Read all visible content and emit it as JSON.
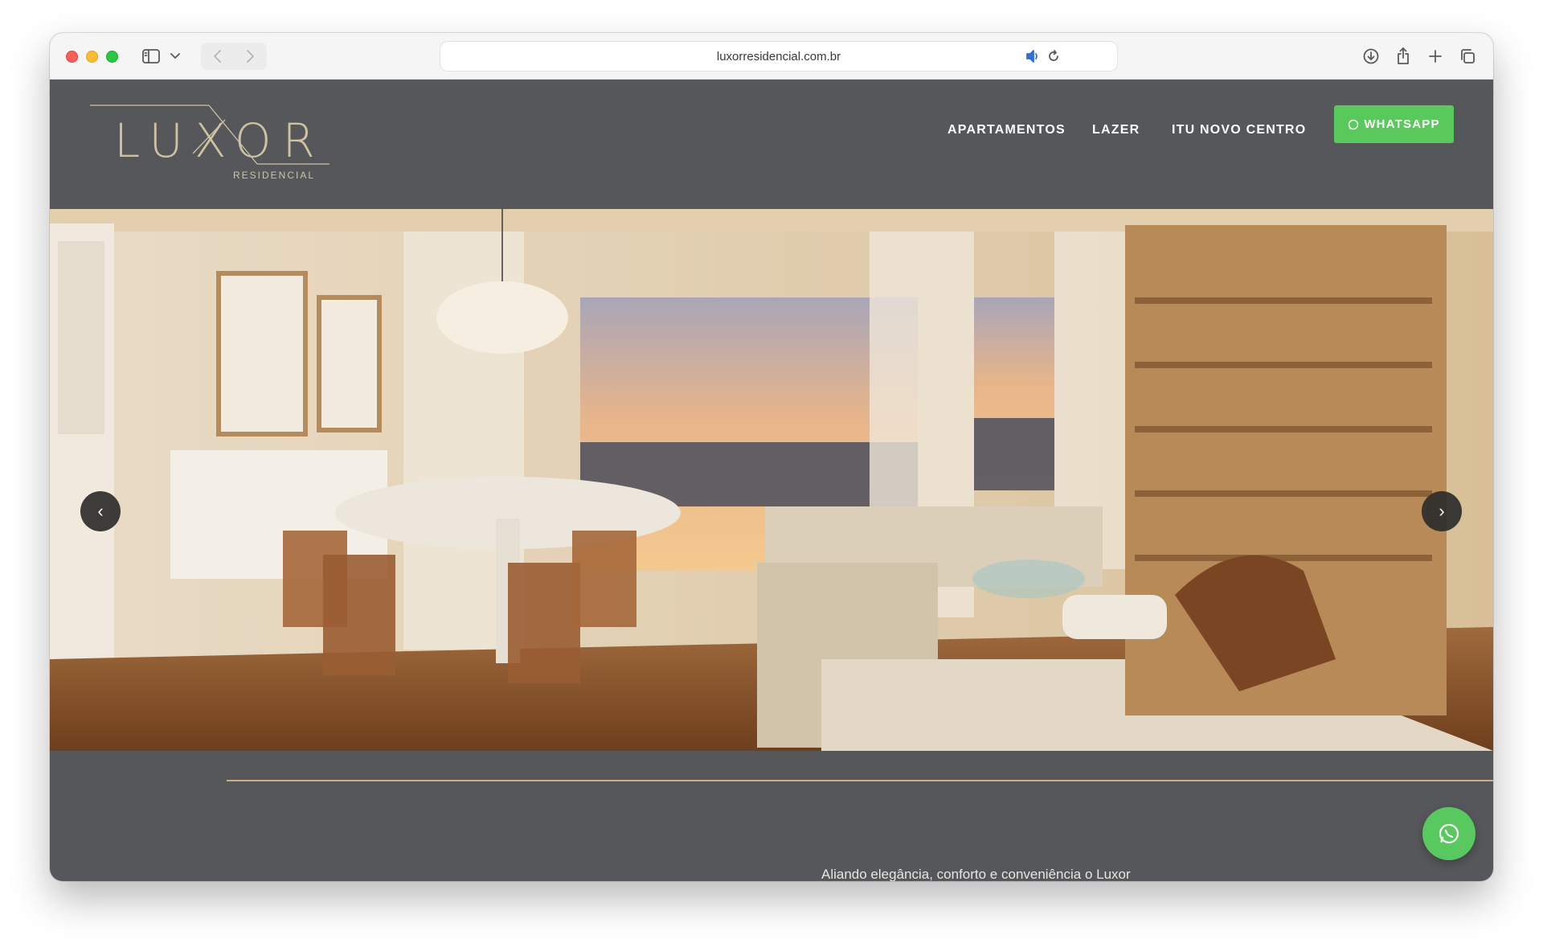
{
  "browser": {
    "url": "luxorresidencial.com.br"
  },
  "site": {
    "logo": {
      "main": "LUXOR",
      "sub": "RESIDENCIAL"
    },
    "nav": [
      {
        "label": "APARTAMENTOS"
      },
      {
        "label": "LAZER"
      },
      {
        "label": "ITU NOVO CENTRO"
      }
    ],
    "whatsapp_label": "WHATSAPP"
  },
  "hero": {
    "prev_label": "‹",
    "next_label": "›"
  },
  "intro": {
    "text": "Aliando elegância, conforto e conveniência o Luxor"
  },
  "colors": {
    "accent_gold": "#c7b287",
    "whatsapp_green": "#5ac95c",
    "header_bg": "#55575a"
  },
  "icons": [
    "sidebar-icon",
    "chevron-down-icon",
    "back-icon",
    "forward-icon",
    "pinterest-icon",
    "reader-icon",
    "speaker-icon",
    "reload-icon",
    "download-icon",
    "share-icon",
    "new-tab-icon",
    "tabs-icon",
    "whatsapp-icon"
  ]
}
